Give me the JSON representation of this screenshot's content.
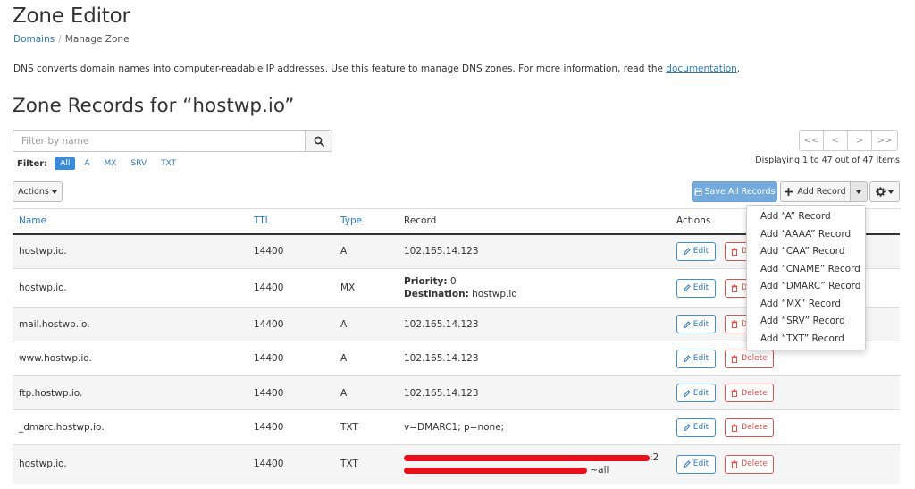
{
  "page": {
    "title": "Zone Editor",
    "breadcrumb": {
      "link": "Domains",
      "separator": "/",
      "current": "Manage Zone"
    },
    "intro_text": "DNS converts domain names into computer-readable IP addresses. Use this feature to manage DNS zones. For more information, read the ",
    "intro_link": "documentation",
    "intro_end": ".",
    "section_title": "Zone Records for “hostwp.io”"
  },
  "search": {
    "placeholder": "Filter by name",
    "icon": "search-icon"
  },
  "filter": {
    "label": "Filter:",
    "options": [
      "All",
      "A",
      "MX",
      "SRV",
      "TXT"
    ],
    "active": "All"
  },
  "pagination": {
    "buttons": [
      "<<",
      "<",
      ">",
      ">>"
    ],
    "status": "Displaying 1 to 47 out of 47 items"
  },
  "toolbar": {
    "actions_label": "Actions",
    "save_all_label": "Save All Records",
    "add_record_label": "Add Record",
    "settings_icon": "gear-icon"
  },
  "add_record_menu": [
    "Add “A” Record",
    "Add “AAAA” Record",
    "Add “CAA” Record",
    "Add “CNAME” Record",
    "Add “DMARC” Record",
    "Add “MX” Record",
    "Add “SRV” Record",
    "Add “TXT” Record"
  ],
  "table": {
    "headers": {
      "name": "Name",
      "ttl": "TTL",
      "type": "Type",
      "record": "Record",
      "actions": "Actions"
    },
    "edit_label": "Edit",
    "delete_label": "Delete",
    "rows": [
      {
        "name": "hostwp.io.",
        "ttl": "14400",
        "type": "A",
        "record": "102.165.14.123"
      },
      {
        "name": "hostwp.io.",
        "ttl": "14400",
        "type": "MX",
        "priority_label": "Priority:",
        "priority": "0",
        "destination_label": "Destination:",
        "destination": "hostwp.io"
      },
      {
        "name": "mail.hostwp.io.",
        "ttl": "14400",
        "type": "A",
        "record": "102.165.14.123"
      },
      {
        "name": "www.hostwp.io.",
        "ttl": "14400",
        "type": "A",
        "record": "102.165.14.123"
      },
      {
        "name": "ftp.hostwp.io.",
        "ttl": "14400",
        "type": "A",
        "record": "102.165.14.123"
      },
      {
        "name": "_dmarc.hostwp.io.",
        "ttl": "14400",
        "type": "TXT",
        "record": "v=DMARC1; p=none;"
      },
      {
        "name": "hostwp.io.",
        "ttl": "14400",
        "type": "TXT",
        "record_line1_tail": ":2",
        "record_line2_tail": "~all"
      }
    ]
  },
  "colors": {
    "link": "#2f78b7",
    "primary_button": "#75abdc",
    "danger": "#d9534f",
    "redaction": "#e8101b"
  }
}
